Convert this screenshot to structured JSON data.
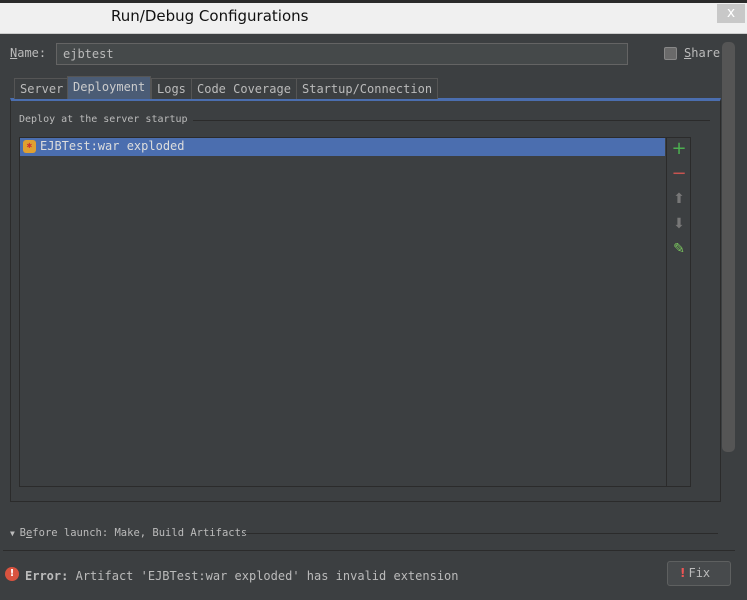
{
  "window": {
    "title": "Run/Debug Configurations",
    "close_label": "x"
  },
  "name": {
    "label_u": "N",
    "label_rest": "ame:",
    "value": "ejbtest"
  },
  "share": {
    "label_u": "S",
    "label_rest": "hare",
    "checked": false
  },
  "tabs": [
    {
      "label": "Server"
    },
    {
      "label": "Deployment",
      "active": true
    },
    {
      "label": "Logs"
    },
    {
      "label": "Code Coverage"
    },
    {
      "label": "Startup/Connection"
    }
  ],
  "deployment": {
    "section_label": "Deploy at the server startup",
    "items": [
      "EJBTest:war exploded"
    ]
  },
  "toolbar": {
    "add": "+",
    "remove": "−",
    "up": "⬆",
    "down": "⬇",
    "edit": "✎"
  },
  "before_launch": {
    "pre": "B",
    "u": "e",
    "label": "fore launch: Make, Build Artifacts"
  },
  "error": {
    "prefix": "Error:",
    "message": "Artifact 'EJBTest:war exploded' has invalid extension",
    "fix_label": "Fix"
  }
}
